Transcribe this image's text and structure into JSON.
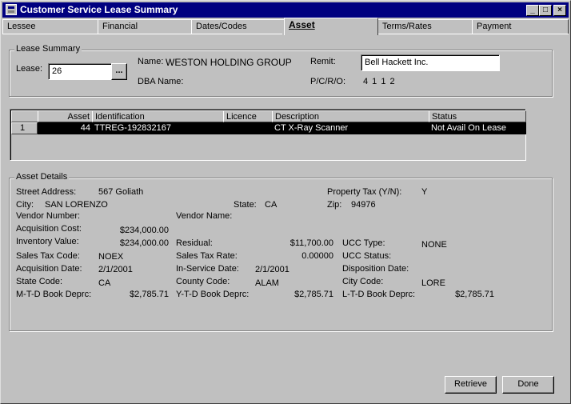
{
  "window": {
    "title": "Customer Service Lease Summary",
    "minimize": "_",
    "maximize": "□",
    "close": "×"
  },
  "tabs": [
    {
      "label": "Lessee"
    },
    {
      "label": "Financial"
    },
    {
      "label": "Dates/Codes"
    },
    {
      "label": "Asset"
    },
    {
      "label": "Terms/Rates"
    },
    {
      "label": "Payment"
    }
  ],
  "lease_summary": {
    "legend": "Lease Summary",
    "lease_label": "Lease:",
    "lease_value": "26",
    "lookup_button": "...",
    "name_label": "Name:",
    "name_value": "WESTON HOLDING GROUP",
    "dba_label": "DBA Name:",
    "remit_label": "Remit:",
    "remit_value": "Bell Hackett Inc.",
    "pcro_label": "P/C/R/O:",
    "pcro_value": "4 1 1 2"
  },
  "asset_grid": {
    "columns": [
      "Asset",
      "Identification",
      "Licence",
      "Description",
      "Status"
    ],
    "rows": [
      {
        "row_num": "1",
        "asset": "44",
        "identification": "TTREG-192832167",
        "licence": "",
        "description": "CT X-Ray Scanner",
        "status": "Not Avail On Lease"
      }
    ]
  },
  "asset_details": {
    "legend": "Asset Details",
    "street_label": "Street Address:",
    "street_value": "567 Goliath",
    "city_label": "City:",
    "city_value": "SAN LORENZO",
    "state_label": "State:",
    "state_value": "CA",
    "property_tax_label": "Property Tax (Y/N):",
    "property_tax_value": "Y",
    "zip_label": "Zip:",
    "zip_value": "94976",
    "vendor_number_label": "Vendor Number:",
    "vendor_name_label": "Vendor Name:",
    "acq_cost_label": "Acquisition Cost:",
    "acq_cost_value": "$234,000.00",
    "inv_value_label": "Inventory Value:",
    "inv_value_value": "$234,000.00",
    "residual_label": "Residual:",
    "residual_value": "$11,700.00",
    "ucc_type_label": "UCC Type:",
    "ucc_type_value": "NONE",
    "sales_tax_code_label": "Sales Tax Code:",
    "sales_tax_code_value": "NOEX",
    "sales_tax_rate_label": "Sales Tax Rate:",
    "sales_tax_rate_value": "0.00000",
    "ucc_status_label": "UCC Status:",
    "acq_date_label": "Acquisition Date:",
    "acq_date_value": "2/1/2001",
    "in_service_label": "In-Service Date:",
    "in_service_value": "2/1/2001",
    "disposition_label": "Disposition Date:",
    "state_code_label": "State Code:",
    "state_code_value": "CA",
    "county_code_label": "County Code:",
    "county_code_value": "ALAM",
    "city_code_label": "City Code:",
    "city_code_value": "LORE",
    "mtd_label": "M-T-D Book Deprc:",
    "mtd_value": "$2,785.71",
    "ytd_label": "Y-T-D Book Deprc:",
    "ytd_value": "$2,785.71",
    "ltd_label": "L-T-D Book Deprc:",
    "ltd_value": "$2,785.71"
  },
  "actions": {
    "retrieve": "Retrieve",
    "done": "Done"
  }
}
